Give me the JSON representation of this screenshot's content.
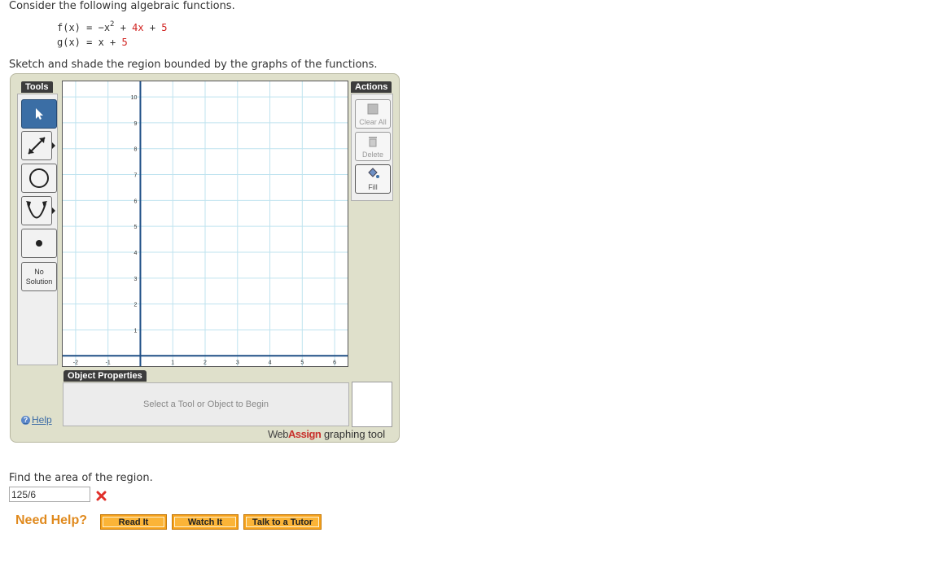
{
  "question": {
    "intro": "Consider the following algebraic functions.",
    "f_lhs": "f(x)",
    "f_rhs_pre": "= −x",
    "f_exp": "2",
    "f_mid": " + ",
    "f_term1": "4x",
    "f_plus": " + ",
    "f_term2": "5",
    "g_lhs": "g(x)",
    "g_rhs_pre": "= x + ",
    "g_term": "5",
    "instruction": "Sketch and shade the region bounded by the graphs of the functions."
  },
  "tool": {
    "tools_label": "Tools",
    "actions_label": "Actions",
    "no_solution_line1": "No",
    "no_solution_line2": "Solution",
    "actions": {
      "clear_all": "Clear All",
      "delete": "Delete",
      "fill": "Fill"
    },
    "object_properties_label": "Object Properties",
    "properties_placeholder": "Select a Tool or Object to Begin",
    "help_label": "Help",
    "brand_web": "Web",
    "brand_assign": "Assign",
    "brand_suffix": " graphing tool",
    "icons": [
      "pointer-icon",
      "line-icon",
      "circle-icon",
      "parabola-icon",
      "point-icon",
      "fill-icon",
      "trash-icon",
      "clear-icon",
      "help-icon"
    ],
    "accent": "#3b6ea5"
  },
  "graph": {
    "x_ticks": [
      "-2",
      "-1",
      "1",
      "2",
      "3",
      "4",
      "5",
      "6"
    ],
    "y_ticks": [
      "10",
      "9",
      "8",
      "7",
      "6",
      "5",
      "4",
      "3",
      "2",
      "1"
    ],
    "xlim": [
      -2.4,
      6.4
    ],
    "ylim": [
      -0.4,
      10.6
    ]
  },
  "area_question": {
    "prompt": "Find the area of the region.",
    "answer": "125/6",
    "status": "incorrect",
    "status_color": "#e0302a"
  },
  "help_bar": {
    "need_help": "Need Help?",
    "read_it": "Read It",
    "watch_it": "Watch It",
    "tutor": "Talk to a Tutor"
  }
}
